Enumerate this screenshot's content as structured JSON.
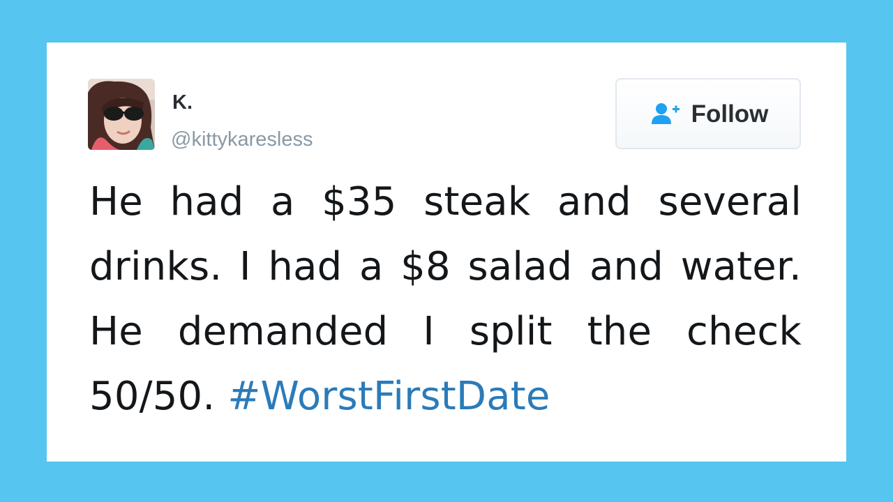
{
  "tweet": {
    "author": {
      "display_name": "K.",
      "handle": "@kittykaresless"
    },
    "follow_button": {
      "label": "Follow",
      "icon": "add-user-icon"
    },
    "body_text": "He had a $35 steak and several drinks. I had a $8 salad and water. He demanded I split the check 50/50.",
    "hashtag": "#WorstFirstDate"
  },
  "colors": {
    "background": "#56c5ef",
    "card": "#ffffff",
    "hashtag": "#2b7bb9",
    "follow_icon": "#1da1f2",
    "handle": "#8899a6"
  }
}
